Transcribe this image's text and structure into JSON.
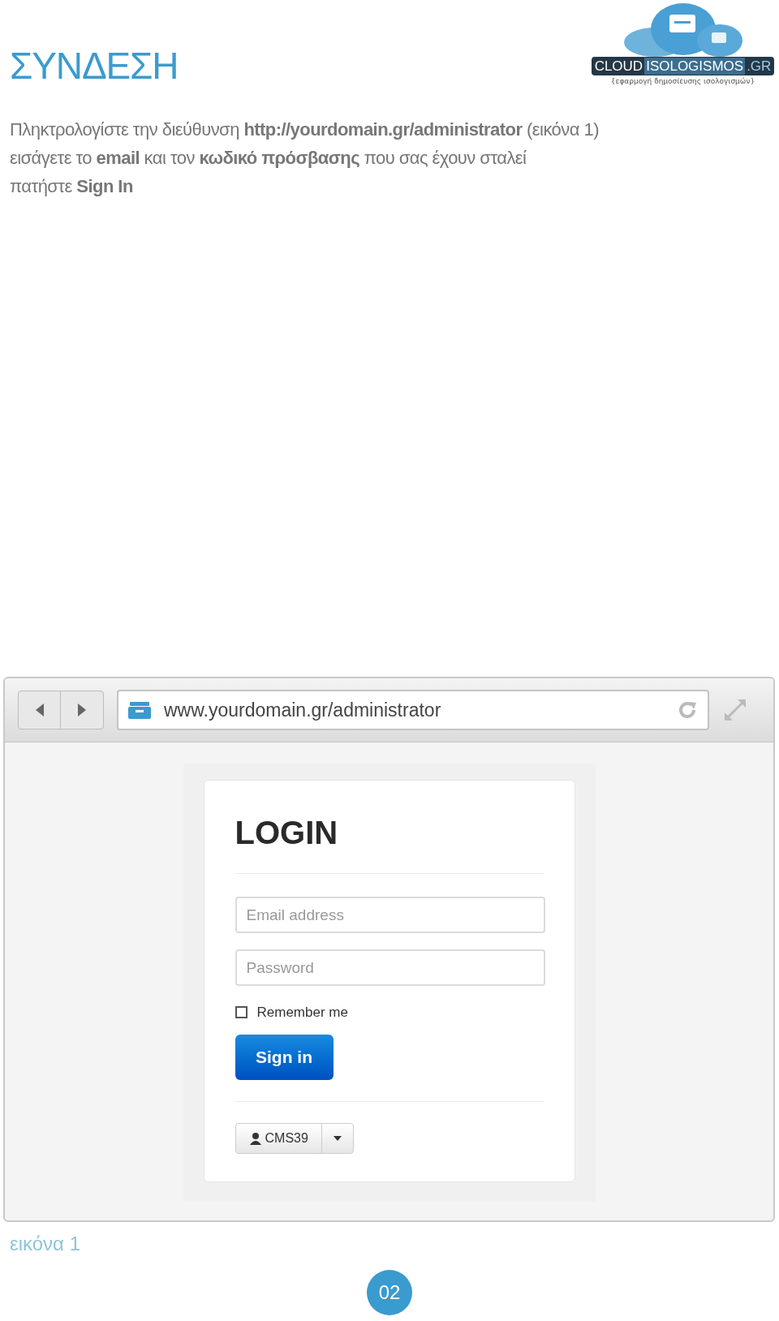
{
  "heading": "ΣΥΝΔΕΣΗ",
  "logo": {
    "parts": [
      "CLOUD",
      "ISOLOGISMOS",
      ".GR"
    ],
    "tagline": "{εφαρμογή δημοσίευσης ισολογισμών}"
  },
  "instructions": [
    "Πληκτρολογίστε την διεύθυνση **http://yourdomain.gr/administrator** (εικόνα 1)",
    "εισάγετε το **email** και τον **κωδικό πρόσβασης** που σας έχουν σταλεί",
    "πατήστε **Sign In**"
  ],
  "browser": {
    "url": "www.yourdomain.gr/administrator",
    "login": {
      "title": "LOGIN",
      "email": {
        "placeholder": "Email address"
      },
      "password": {
        "placeholder": "Password"
      },
      "remember": {
        "label": "Remember me",
        "checked": false
      },
      "submit": "Sign in",
      "user_menu": "CMS39"
    }
  },
  "caption": "εικόνα 1",
  "page_number": "02"
}
